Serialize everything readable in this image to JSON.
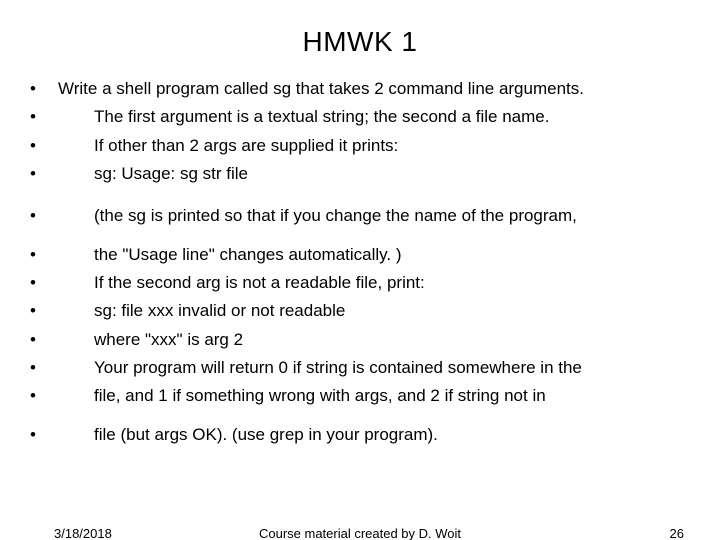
{
  "title": "HMWK 1",
  "bullets": [
    {
      "indent": 0,
      "text": "Write a shell program called sg that takes 2 command line arguments."
    },
    {
      "indent": 1,
      "text": "The first argument is a textual string; the second a file name."
    },
    {
      "indent": 1,
      "text": "If other than 2 args are supplied it prints:"
    },
    {
      "indent": 1,
      "text": "sg: Usage: sg str file"
    }
  ],
  "bullets_group2": [
    {
      "indent": 1,
      "text": "(the sg is printed so that if you change the name of the program,"
    }
  ],
  "bullets_group3": [
    {
      "indent": 1,
      "text": "the \"Usage line\" changes automatically. )"
    },
    {
      "indent": 1,
      "text": "If the second arg is not a readable file, print:"
    },
    {
      "indent": 1,
      "text": "sg: file xxx invalid or not readable"
    },
    {
      "indent": 1,
      "text": "where \"xxx\" is arg 2"
    },
    {
      "indent": 1,
      "text": "Your program will return 0 if string is contained somewhere in the"
    },
    {
      "indent": 1,
      "text": "file, and 1 if something wrong with args, and 2 if string not in"
    }
  ],
  "bullets_group4": [
    {
      "indent": 1,
      "text": "file (but args OK).  (use grep in your program)."
    }
  ],
  "footer": {
    "date": "3/18/2018",
    "center": "Course material created by D. Woit",
    "page": "26"
  }
}
